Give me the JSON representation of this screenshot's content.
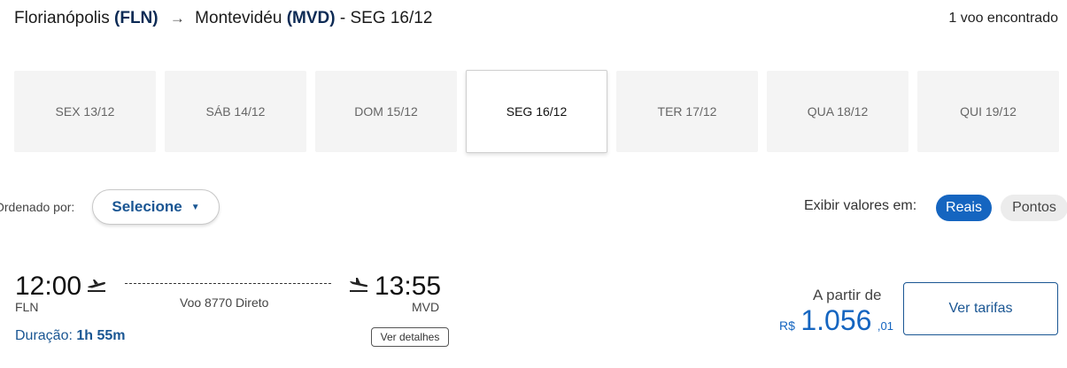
{
  "header": {
    "origin_city": "Florianópolis",
    "origin_code": "(FLN)",
    "destination_city": "Montevidéu",
    "destination_code": "(MVD)",
    "date_suffix": "- SEG 16/12",
    "result_count": "1 voo encontrado"
  },
  "date_tabs": [
    {
      "label": "SEX 13/12"
    },
    {
      "label": "SÁB 14/12"
    },
    {
      "label": "DOM 15/12"
    },
    {
      "label": "SEG 16/12",
      "selected": true
    },
    {
      "label": "TER 17/12"
    },
    {
      "label": "QUA 18/12"
    },
    {
      "label": "QUI 19/12"
    }
  ],
  "sort": {
    "label": "Ordenado por:",
    "value": "Selecione"
  },
  "values_toggle": {
    "label": "Exibir valores em:",
    "options": [
      "Reais",
      "Pontos"
    ],
    "selected": "Reais"
  },
  "flight": {
    "departure_time": "12:00",
    "departure_code": "FLN",
    "arrival_time": "13:55",
    "arrival_code": "MVD",
    "info": "Voo 8770 Direto",
    "duration_label": "Duração:",
    "duration_value": "1h 55m",
    "details_button": "Ver detalhes",
    "price_from_label": "A partir de",
    "price_currency": "R$",
    "price_integer": "1.056",
    "price_cents": ",01",
    "fares_button": "Ver tarifas"
  },
  "colors": {
    "accent": "#1565c0",
    "link": "#1a5693"
  },
  "icons": {
    "departure": "takeoff-icon",
    "arrival": "landing-icon",
    "route_arrow": "arrow-right-icon",
    "dropdown": "caret-down-icon"
  }
}
